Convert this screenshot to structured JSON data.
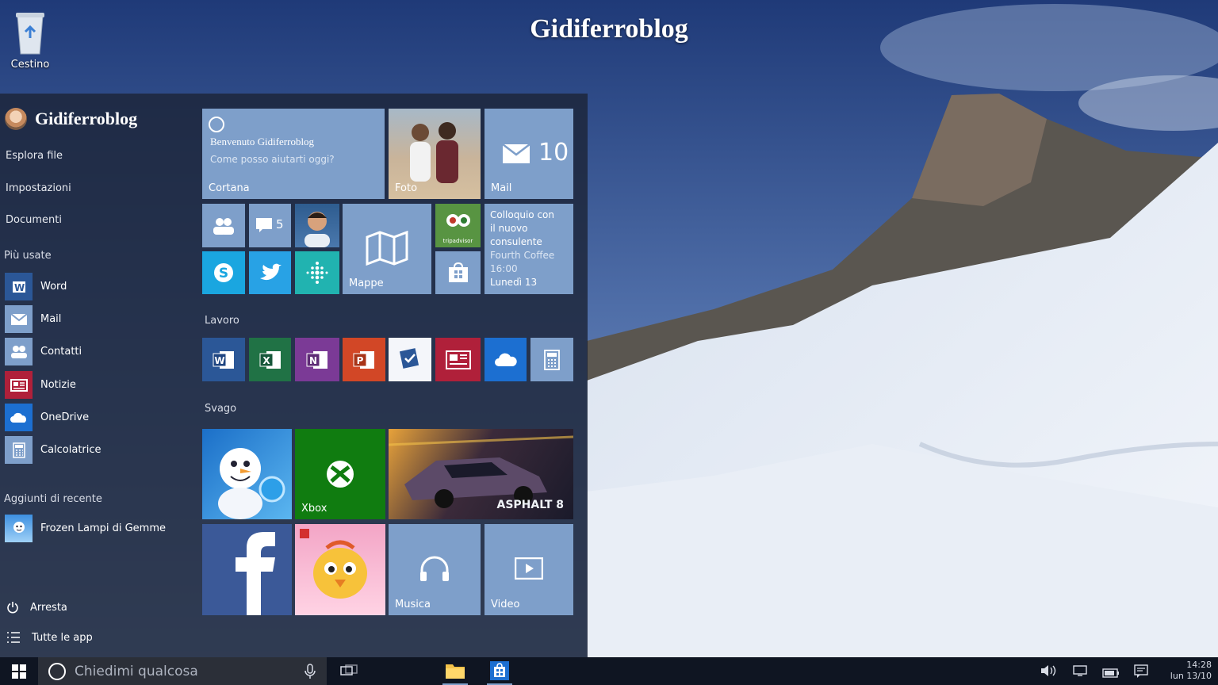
{
  "page_title": "Gidiferroblog",
  "desktop": {
    "recycle_bin_label": "Cestino"
  },
  "start_menu": {
    "user_name": "Gidiferroblog",
    "nav": [
      "Esplora file",
      "Impostazioni",
      "Documenti"
    ],
    "most_used_label": "Più usate",
    "most_used": [
      {
        "label": "Word",
        "icon": "word-icon"
      },
      {
        "label": "Mail",
        "icon": "mail-icon"
      },
      {
        "label": "Contatti",
        "icon": "people-icon"
      },
      {
        "label": "Notizie",
        "icon": "news-icon"
      },
      {
        "label": "OneDrive",
        "icon": "cloud-icon"
      },
      {
        "label": "Calcolatrice",
        "icon": "calculator-icon"
      }
    ],
    "recent_label": "Aggiunti di recente",
    "recent": [
      {
        "label": "Frozen Lampi di Gemme",
        "icon": "frozen-icon"
      }
    ],
    "power_label": "Arresta",
    "all_apps_label": "Tutte le app"
  },
  "tiles": {
    "cortana": {
      "title": "Benvenuto Gidiferroblog",
      "subtitle": "Come posso aiutarti oggi?",
      "label": "Cortana"
    },
    "photos": {
      "label": "Foto"
    },
    "mail": {
      "label": "Mail",
      "count": "10"
    },
    "messaging_count": "5",
    "maps": {
      "label": "Mappe"
    },
    "tripadvisor_label": "tripadvisor",
    "calendar": {
      "line1": "Colloquio con",
      "line2": "il nuovo",
      "line3": "consulente",
      "line4": "Fourth Coffee",
      "line5": "16:00",
      "line6": "Lunedì 13"
    },
    "work_group_label": "Lavoro",
    "play_group_label": "Svago",
    "xbox": {
      "label": "Xbox"
    },
    "music": {
      "label": "Musica"
    },
    "video": {
      "label": "Video"
    },
    "asphalt_label": "ASPHALT 8"
  },
  "taskbar": {
    "search_placeholder": "Chiedimi qualcosa",
    "clock_time": "14:28",
    "clock_date": "lun 13/10"
  },
  "colors": {
    "tile_blue": "#7e9fca",
    "word_blue": "#2b5797",
    "excel_green": "#207245",
    "onenote_purple": "#7b3a96",
    "powerpoint_orange": "#d24726",
    "news_red": "#b0203a",
    "onedrive_blue": "#1c6fd1",
    "skype_blue": "#1aa6e0",
    "twitter_blue": "#28a2e5",
    "fitbit_teal": "#21b3b0",
    "tripadvisor_green": "#589442",
    "xbox_green": "#107c10",
    "facebook_blue": "#3b5998"
  }
}
